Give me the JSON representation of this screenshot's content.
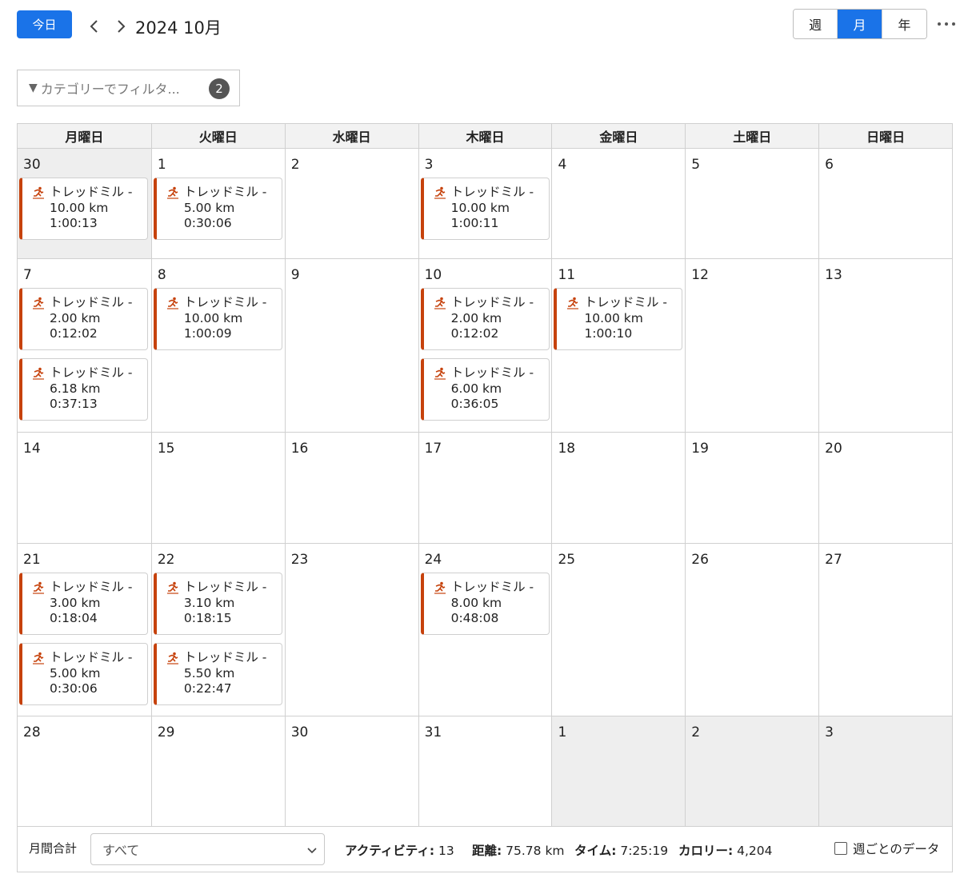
{
  "toolbar": {
    "today_label": "今日",
    "title": "2024 10月",
    "views": [
      {
        "label": "週",
        "active": false
      },
      {
        "label": "月",
        "active": true
      },
      {
        "label": "年",
        "active": false
      }
    ]
  },
  "filter": {
    "icon": "filter-triangle-icon",
    "placeholder": "カテゴリーでフィルタ...",
    "badge_count": "2"
  },
  "calendar": {
    "weekdays": [
      "月曜日",
      "火曜日",
      "水曜日",
      "木曜日",
      "金曜日",
      "土曜日",
      "日曜日"
    ],
    "event_icon": "running-person-icon",
    "event_color": "#c6420c",
    "weeks": [
      [
        {
          "day": "30",
          "outside": true,
          "events": [
            {
              "name": "トレッドミル -",
              "distance": "10.00 km",
              "time": "1:00:13"
            }
          ]
        },
        {
          "day": "1",
          "outside": false,
          "events": [
            {
              "name": "トレッドミル -",
              "distance": "5.00 km",
              "time": "0:30:06"
            }
          ]
        },
        {
          "day": "2",
          "outside": false,
          "events": []
        },
        {
          "day": "3",
          "outside": false,
          "events": [
            {
              "name": "トレッドミル -",
              "distance": "10.00 km",
              "time": "1:00:11"
            }
          ]
        },
        {
          "day": "4",
          "outside": false,
          "events": []
        },
        {
          "day": "5",
          "outside": false,
          "events": []
        },
        {
          "day": "6",
          "outside": false,
          "events": []
        }
      ],
      [
        {
          "day": "7",
          "outside": false,
          "events": [
            {
              "name": "トレッドミル -",
              "distance": "2.00 km",
              "time": "0:12:02"
            },
            {
              "name": "トレッドミル -",
              "distance": "6.18 km",
              "time": "0:37:13"
            }
          ]
        },
        {
          "day": "8",
          "outside": false,
          "events": [
            {
              "name": "トレッドミル -",
              "distance": "10.00 km",
              "time": "1:00:09"
            }
          ]
        },
        {
          "day": "9",
          "outside": false,
          "events": []
        },
        {
          "day": "10",
          "outside": false,
          "events": [
            {
              "name": "トレッドミル -",
              "distance": "2.00 km",
              "time": "0:12:02"
            },
            {
              "name": "トレッドミル -",
              "distance": "6.00 km",
              "time": "0:36:05"
            }
          ]
        },
        {
          "day": "11",
          "outside": false,
          "events": [
            {
              "name": "トレッドミル -",
              "distance": "10.00 km",
              "time": "1:00:10"
            }
          ]
        },
        {
          "day": "12",
          "outside": false,
          "events": []
        },
        {
          "day": "13",
          "outside": false,
          "events": []
        }
      ],
      [
        {
          "day": "14",
          "outside": false,
          "events": []
        },
        {
          "day": "15",
          "outside": false,
          "events": []
        },
        {
          "day": "16",
          "outside": false,
          "events": []
        },
        {
          "day": "17",
          "outside": false,
          "events": []
        },
        {
          "day": "18",
          "outside": false,
          "events": []
        },
        {
          "day": "19",
          "outside": false,
          "events": []
        },
        {
          "day": "20",
          "outside": false,
          "events": []
        }
      ],
      [
        {
          "day": "21",
          "outside": false,
          "events": [
            {
              "name": "トレッドミル -",
              "distance": "3.00 km",
              "time": "0:18:04"
            },
            {
              "name": "トレッドミル -",
              "distance": "5.00 km",
              "time": "0:30:06"
            }
          ]
        },
        {
          "day": "22",
          "outside": false,
          "events": [
            {
              "name": "トレッドミル -",
              "distance": "3.10 km",
              "time": "0:18:15"
            },
            {
              "name": "トレッドミル -",
              "distance": "5.50 km",
              "time": "0:22:47"
            }
          ]
        },
        {
          "day": "23",
          "outside": false,
          "events": []
        },
        {
          "day": "24",
          "outside": false,
          "events": [
            {
              "name": "トレッドミル -",
              "distance": "8.00 km",
              "time": "0:48:08"
            }
          ]
        },
        {
          "day": "25",
          "outside": false,
          "events": []
        },
        {
          "day": "26",
          "outside": false,
          "events": []
        },
        {
          "day": "27",
          "outside": false,
          "events": []
        }
      ],
      [
        {
          "day": "28",
          "outside": false,
          "events": []
        },
        {
          "day": "29",
          "outside": false,
          "events": []
        },
        {
          "day": "30",
          "outside": false,
          "events": []
        },
        {
          "day": "31",
          "outside": false,
          "events": []
        },
        {
          "day": "1",
          "outside": true,
          "events": []
        },
        {
          "day": "2",
          "outside": true,
          "events": []
        },
        {
          "day": "3",
          "outside": true,
          "events": []
        }
      ]
    ]
  },
  "footer": {
    "label": "月間合計",
    "select_value": "すべて",
    "activities_label": "アクティビティ:",
    "activities_value": "13",
    "distance_label": "距離:",
    "distance_value": "75.78 km",
    "time_label": "タイム:",
    "time_value": "7:25:19",
    "calories_label": "カロリー:",
    "calories_value": "4,204",
    "weekly_label": "週ごとのデータ",
    "weekly_checked": false
  },
  "colors": {
    "accent": "#1a73e8",
    "event_bar": "#c6420c",
    "outside_day": "#eeeeee"
  }
}
